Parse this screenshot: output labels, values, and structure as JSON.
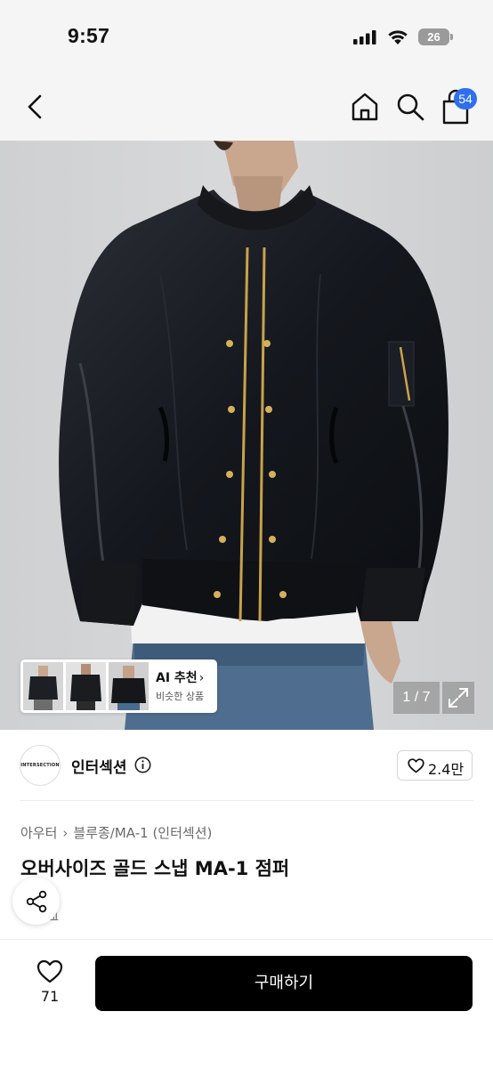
{
  "status_bar": {
    "time": "9:57",
    "battery": "26"
  },
  "nav": {
    "cart_count": "54"
  },
  "gallery": {
    "ai_title": "AI 추천",
    "ai_chevron": "›",
    "ai_subtitle": "비슷한 상품",
    "page_indicator": "1 / 7"
  },
  "shop": {
    "logo_text": "INTERSECTION",
    "name": "인터섹션",
    "like_count": "2.4만"
  },
  "breadcrumb": {
    "category": "아우터",
    "separator": "›",
    "subcategory": "블루종/MA-1 (인터섹션)"
  },
  "product": {
    "title": "오버사이즈 골드 스냅 MA-1 점퍼",
    "meta_partial": "개"
  },
  "bottom_bar": {
    "wish_count": "71",
    "buy_label": "구매하기"
  },
  "colors": {
    "badge_blue": "#2e6ff0",
    "buy_button_bg": "#000000",
    "header_bg": "#f5f5f5"
  },
  "icons": [
    "back-icon",
    "home-icon",
    "search-icon",
    "cart-icon",
    "info-icon",
    "heart-icon",
    "share-icon",
    "expand-icon",
    "signal-icon",
    "wifi-icon",
    "battery-icon"
  ]
}
